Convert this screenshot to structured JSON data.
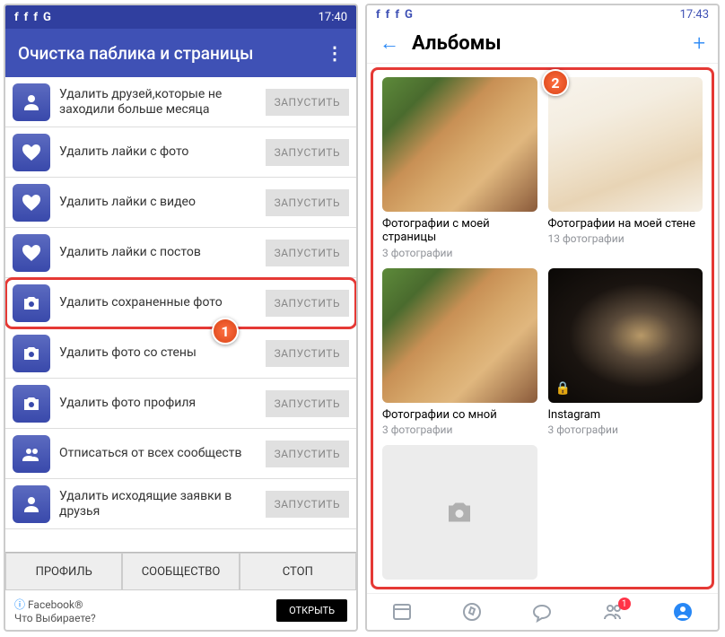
{
  "phone1": {
    "status_time": "17:40",
    "status_icons": [
      "f",
      "f",
      "f",
      "G"
    ],
    "appbar_title": "Очистка паблика и страницы",
    "run_label": "ЗАПУСТИТЬ",
    "items": [
      {
        "icon": "person",
        "label": "Удалить друзей,которые не заходили больше месяца"
      },
      {
        "icon": "heart",
        "label": "Удалить лайки с фото"
      },
      {
        "icon": "heart",
        "label": "Удалить лайки с видео"
      },
      {
        "icon": "heart",
        "label": "Удалить лайки с постов"
      },
      {
        "icon": "camera",
        "label": "Удалить сохраненные фото",
        "highlight": true
      },
      {
        "icon": "camera",
        "label": "Удалить фото со стены"
      },
      {
        "icon": "camera",
        "label": "Удалить фото профиля"
      },
      {
        "icon": "group",
        "label": "Отписаться от всех сообществ"
      },
      {
        "icon": "person",
        "label": "Удалить исходящие заявки в друзья"
      }
    ],
    "bottom": {
      "profile": "ПРОФИЛЬ",
      "community": "СООБЩЕСТВО",
      "stop": "СТОП"
    },
    "ad": {
      "line1": "Facebook®",
      "line2": "Что Выбираете?",
      "open": "ОТКРЫТЬ"
    }
  },
  "phone2": {
    "status_time": "17:43",
    "status_icons": [
      "f",
      "f",
      "f",
      "G"
    ],
    "title": "Альбомы",
    "albums": [
      {
        "thumb": "dog",
        "title": "Фотографии с моей страницы",
        "count": "3 фотографии"
      },
      {
        "thumb": "fox",
        "title": "Фотографии на моей стене",
        "count": "13 фотографии"
      },
      {
        "thumb": "dog",
        "title": "Фотографии со мной",
        "count": "3 фотографии"
      },
      {
        "thumb": "space",
        "title": "Instagram",
        "count": "3 фотографии",
        "lock": true
      }
    ],
    "nav_badge": "1"
  },
  "callouts": {
    "c1": "1",
    "c2": "2"
  }
}
